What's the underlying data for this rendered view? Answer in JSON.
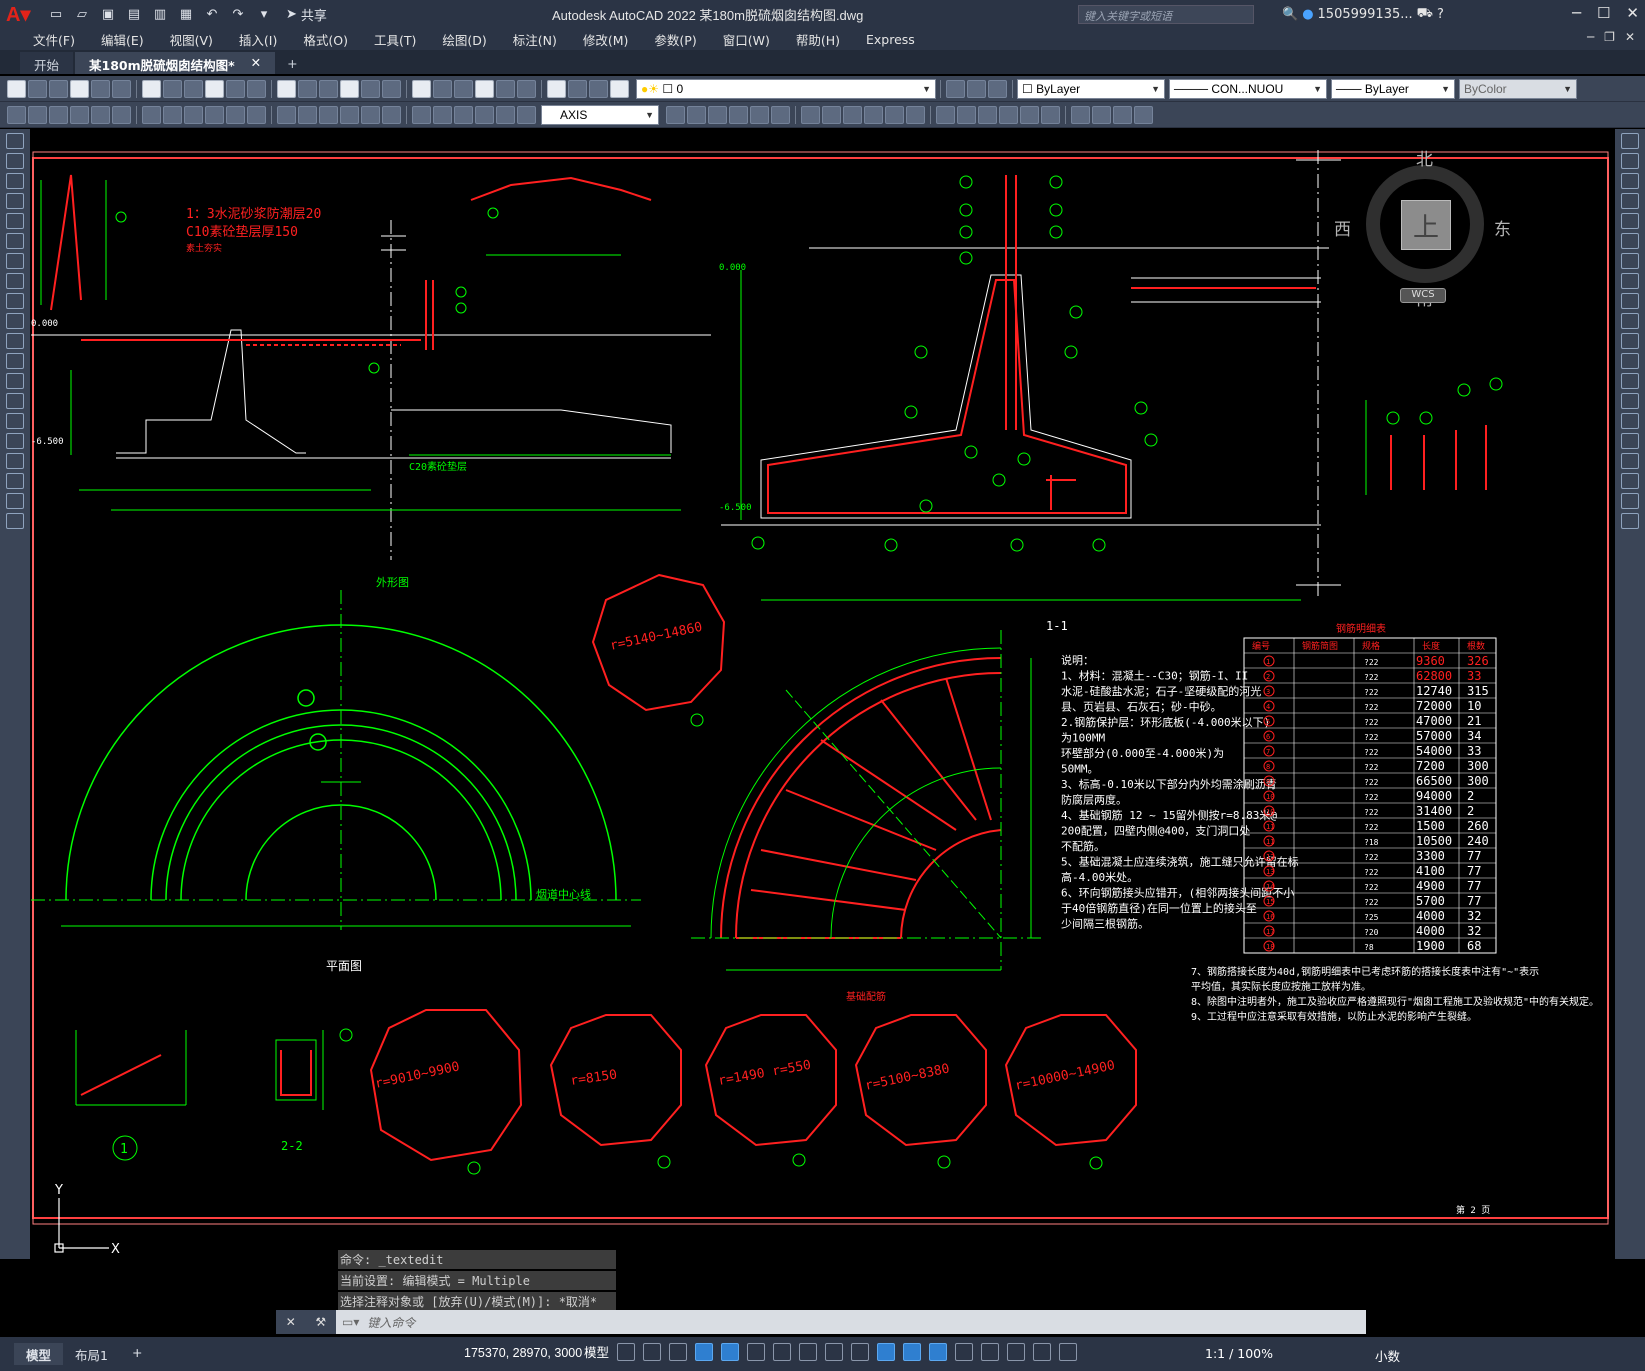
{
  "titlebar": {
    "share_label": "共享",
    "title": "Autodesk AutoCAD 2022    某180m脱硫烟囱结构图.dwg",
    "search_placeholder": "键入关键字或短语",
    "user": "1505999135..."
  },
  "menu": [
    "文件(F)",
    "编辑(E)",
    "视图(V)",
    "插入(I)",
    "格式(O)",
    "工具(T)",
    "绘图(D)",
    "标注(N)",
    "修改(M)",
    "参数(P)",
    "窗口(W)",
    "帮助(H)",
    "Express"
  ],
  "tabs": {
    "start": "开始",
    "active": "某180m脱硫烟囱结构图*",
    "plus": "+"
  },
  "toolbar1": {
    "layer_value": "0",
    "color_value": "ByLayer",
    "linetype_value": "CON...NUOU",
    "lineweight_value": "ByLayer",
    "plotstyle_value": "ByColor"
  },
  "toolbar2": {
    "dimstyle_value": "AXIS"
  },
  "viewcube": {
    "north": "北",
    "south": "南",
    "east": "东",
    "west": "西",
    "top": "上",
    "wcs": "WCS"
  },
  "drawing": {
    "section_label": "1-1",
    "outer_view_label": "外形图",
    "plan_label": "平面图",
    "chimney_center": "烟道中心线",
    "found_label": "基础配筋",
    "section22": "2-2",
    "circle1_label": "1",
    "mat_label1": "1：3水泥砂浆防潮层20",
    "mat_label2": "C10素砼垫层厚150",
    "mat_label3": "素土夯实",
    "c20_label": "C20素砼垫层",
    "elev_0": "0.000",
    "elev_neg6500": "-6.500",
    "r_labels": [
      "r=5140~14860",
      "r=9010~9900",
      "r=8150",
      "r=1490\nr=550",
      "r=5100~8380",
      "r=10000~14900"
    ],
    "notes": [
      "说明：",
      "1、材料：混凝土--C30；钢筋-I、II",
      "   水泥-硅酸盐水泥；石子-坚硬级配的河光",
      "   县、页岩县、石灰石；砂-中砂。",
      "2.钢筋保护层：环形底板(-4.000米以下)",
      "   为100MM",
      "   环壁部分(0.000至-4.000米)为",
      "   50MM。",
      "3、标高-0.10米以下部分内外均需涂刷沥青",
      "   防腐层两度。",
      "4、基础钢筋 12 ~ 15留外侧按r=8.83米@",
      "   200配置，四壁内侧@400，支门洞口处",
      "   不配筋。",
      "5、基础混凝土应连续浇筑，施工缝只允许留在标",
      "   高-4.00米处。",
      "6、环向钢筋接头应错开，(相邻两接头间距不小",
      "   于40倍钢筋直径)在同一位置上的接头至",
      "   少间隔三根钢筋。"
    ],
    "notes2": [
      "7、钢筋搭接长度为40d,钢筋明细表中已考虑环筋的搭接长度表中注有\"~\"表示",
      "   平均值，其实际长度应按施工放样为准。",
      "8、除图中注明者外，施工及验收应严格遵照现行\"烟囱工程施工及验收规范\"中的有关规定。",
      "9、工过程中应注意采取有效措施，以防止水泥的影响产生裂缝。"
    ],
    "table": {
      "title": "钢筋明细表",
      "headers": [
        "编号",
        "钢筋简图",
        "规格",
        "长度",
        "根数"
      ],
      "rows": [
        [
          "1",
          "",
          "?22",
          "9360",
          "326"
        ],
        [
          "2",
          "",
          "?22",
          "62800",
          "33"
        ],
        [
          "3",
          "",
          "?22",
          "12740",
          "315"
        ],
        [
          "4",
          "",
          "?22",
          "72000",
          "10"
        ],
        [
          "5",
          "",
          "?22",
          "47000",
          "21"
        ],
        [
          "6",
          "",
          "?22",
          "57000",
          "34"
        ],
        [
          "7",
          "",
          "?22",
          "54000",
          "33"
        ],
        [
          "8",
          "",
          "?22",
          "7200",
          "300"
        ],
        [
          "9",
          "",
          "?22",
          "66500",
          "300"
        ],
        [
          "10",
          "",
          "?22",
          "94000",
          "2"
        ],
        [
          "10",
          "",
          "?22",
          "31400",
          "2"
        ],
        [
          "11",
          "",
          "?22",
          "1500",
          "260"
        ],
        [
          "11",
          "",
          "?18",
          "10500",
          "240"
        ],
        [
          "12",
          "",
          "?22",
          "3300",
          "77"
        ],
        [
          "13",
          "",
          "?22",
          "4100",
          "77"
        ],
        [
          "14",
          "",
          "?22",
          "4900",
          "77"
        ],
        [
          "15",
          "",
          "?22",
          "5700",
          "77"
        ],
        [
          "16",
          "",
          "?25",
          "4000",
          "32"
        ],
        [
          "17",
          "",
          "?20",
          "4000",
          "32"
        ],
        [
          "18",
          "",
          "?8",
          "1900",
          "68"
        ]
      ]
    },
    "footer_sheet": "第 2 页"
  },
  "command": {
    "history": [
      "命令: _textedit",
      "当前设置: 编辑模式 = Multiple",
      "选择注释对象或 [放弃(U)/模式(M)]: *取消*"
    ],
    "prompt": "键入命令"
  },
  "status": {
    "model_tab": "模型",
    "layout_tab": "布局1",
    "plus": "+",
    "coords": "175370, 28970, 3000",
    "space": "模型",
    "scale": "1:1 / 100%",
    "units": "小数"
  },
  "colors": {
    "accent": "#2f7fd0",
    "cad_green": "#00ff00",
    "cad_red": "#ff2020",
    "cad_white": "#ffffff"
  }
}
